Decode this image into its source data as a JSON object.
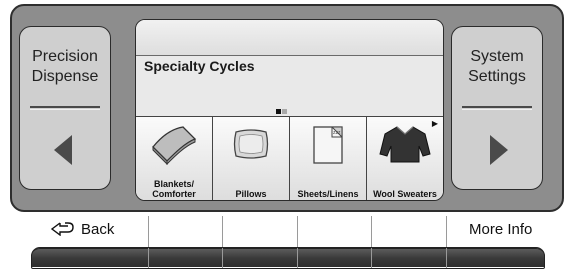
{
  "left_button": {
    "line1": "Precision",
    "line2": "Dispense",
    "arrow_icon": "triangle-left-icon"
  },
  "right_button": {
    "line1": "System",
    "line2": "Settings",
    "arrow_icon": "triangle-right-icon"
  },
  "screen": {
    "title": "Specialty Cycles",
    "page_indicator": {
      "current": 1,
      "total": 2
    },
    "tiles": [
      {
        "label_line1": "Blankets/",
        "label_line2": "Comforter",
        "icon": "blanket-icon"
      },
      {
        "label_line1": "Pillows",
        "label_line2": "",
        "icon": "pillow-icon"
      },
      {
        "label_line1": "Sheets/Linens",
        "label_line2": "",
        "icon": "sheets-icon"
      },
      {
        "label_line1": "Wool Sweaters",
        "label_line2": "",
        "icon": "sweater-icon",
        "more_icon": "more-arrow-icon"
      }
    ]
  },
  "softkeys": [
    {
      "label": "Back",
      "icon": "back-arrow-icon"
    },
    {
      "label": ""
    },
    {
      "label": ""
    },
    {
      "label": ""
    },
    {
      "label": ""
    },
    {
      "label": "More Info"
    }
  ],
  "colors": {
    "panel": "#8d8d8d",
    "button": "#cfcfcf",
    "screen": "#e9e9e9",
    "key": "#3a3a3a"
  }
}
